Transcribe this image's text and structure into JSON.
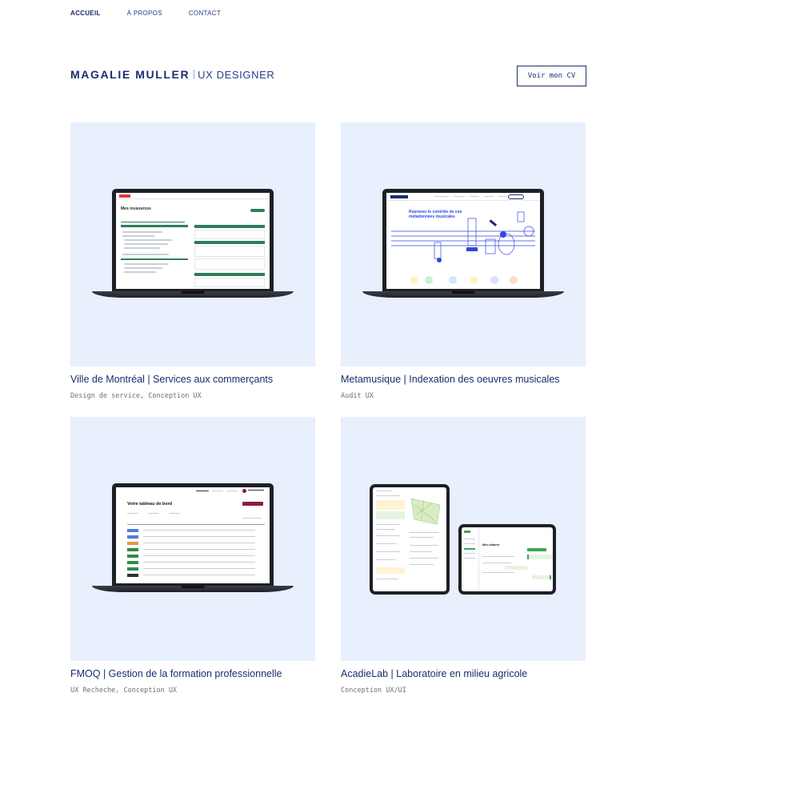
{
  "nav": {
    "items": [
      {
        "label": "ACCUEIL",
        "active": true
      },
      {
        "label": "À PROPOS",
        "active": false
      },
      {
        "label": "CONTACT",
        "active": false
      }
    ]
  },
  "header": {
    "name": "MAGALIE MULLER",
    "role": "UX DESIGNER",
    "cv_button": "Voir mon CV"
  },
  "projects": [
    {
      "title": "Ville de Montréal | Services aux commerçants",
      "tags": "Design de service, Conception UX",
      "screen_title": "Mes ressources"
    },
    {
      "title": "Metamusique | Indexation des oeuvres musicales",
      "tags": "Audit UX",
      "screen_title": "Reprenez le contrôle de vos métadonnées musicales"
    },
    {
      "title": "FMOQ | Gestion de la formation professionnelle",
      "tags": "UX Recheche, Conception UX",
      "screen_title": "Votre tableau de bord"
    },
    {
      "title": "AcadieLab | Laboratoire en milieu agricole",
      "tags": "Conception UX/UI",
      "screen_title": "Mes cultures"
    }
  ],
  "colors": {
    "brand": "#1c2d6e",
    "card_bg": "#e8effd",
    "montreal_green": "#2e7d5b",
    "metamusique_blue": "#3047e0",
    "fmoq_maroon": "#8c1d3a",
    "acadie_green": "#3aa55b"
  }
}
